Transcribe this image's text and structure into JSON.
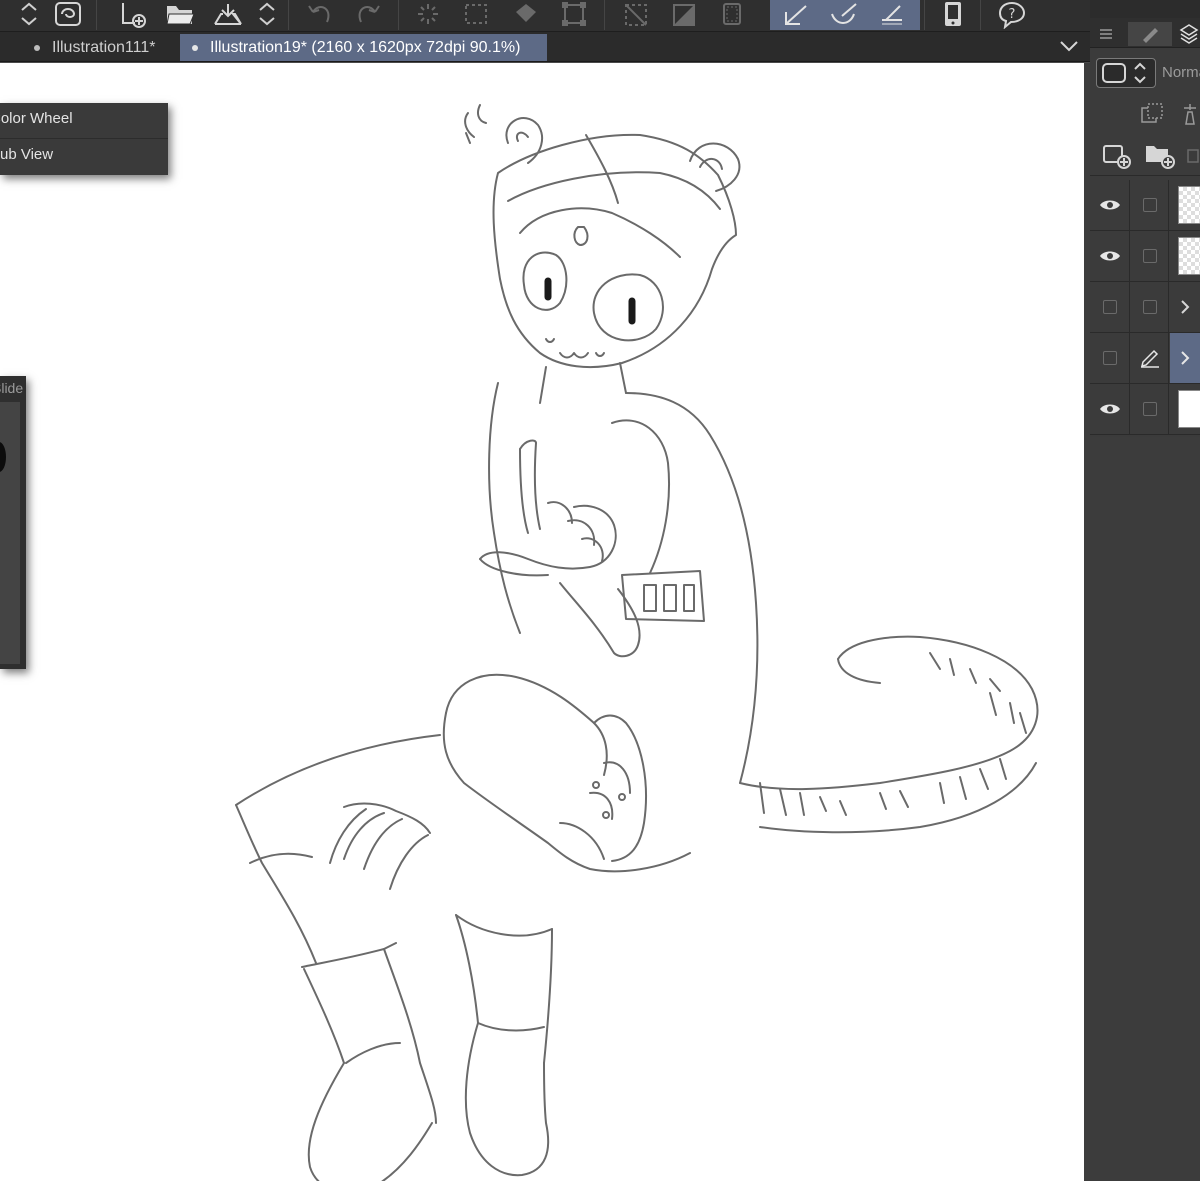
{
  "toolbar": {
    "icons": [
      "chevron-updown-icon",
      "spiral-icon",
      "new-canvas-icon",
      "open-folder-icon",
      "export-icon",
      "chevron-updown-icon",
      "undo-icon",
      "redo-icon",
      "loading-spinner-icon",
      "selection-dashed-icon",
      "fill-bucket-icon",
      "transform-icon",
      "snap-off-icon",
      "snap-ruler-icon",
      "snap-grid-icon",
      "pen-tool-icon",
      "curve-ruler-icon",
      "ruler-icon",
      "smartphone-icon",
      "help-icon"
    ],
    "active_color": "#5d6a86"
  },
  "tabs": [
    {
      "label": "Illustration111*",
      "active": false
    },
    {
      "label": "Illustration19* (2160 x 1620px 72dpi 90.1%)",
      "active": true
    }
  ],
  "popup_menu": {
    "items": [
      "Color Wheel",
      "Sub View"
    ]
  },
  "sub_palette": {
    "header": "Slide"
  },
  "layer_panel": {
    "blend_mode": "Normal",
    "layers": [
      {
        "visible": true,
        "type": "raster",
        "thumb": "transparent",
        "selected": false
      },
      {
        "visible": true,
        "type": "raster",
        "thumb": "transparent",
        "selected": false
      },
      {
        "visible": false,
        "type": "folder",
        "thumb": "none",
        "selected": false
      },
      {
        "visible": false,
        "type": "folder",
        "thumb": "none",
        "selected": true,
        "editing": true
      },
      {
        "visible": true,
        "type": "paper",
        "thumb": "white",
        "selected": false
      }
    ]
  }
}
